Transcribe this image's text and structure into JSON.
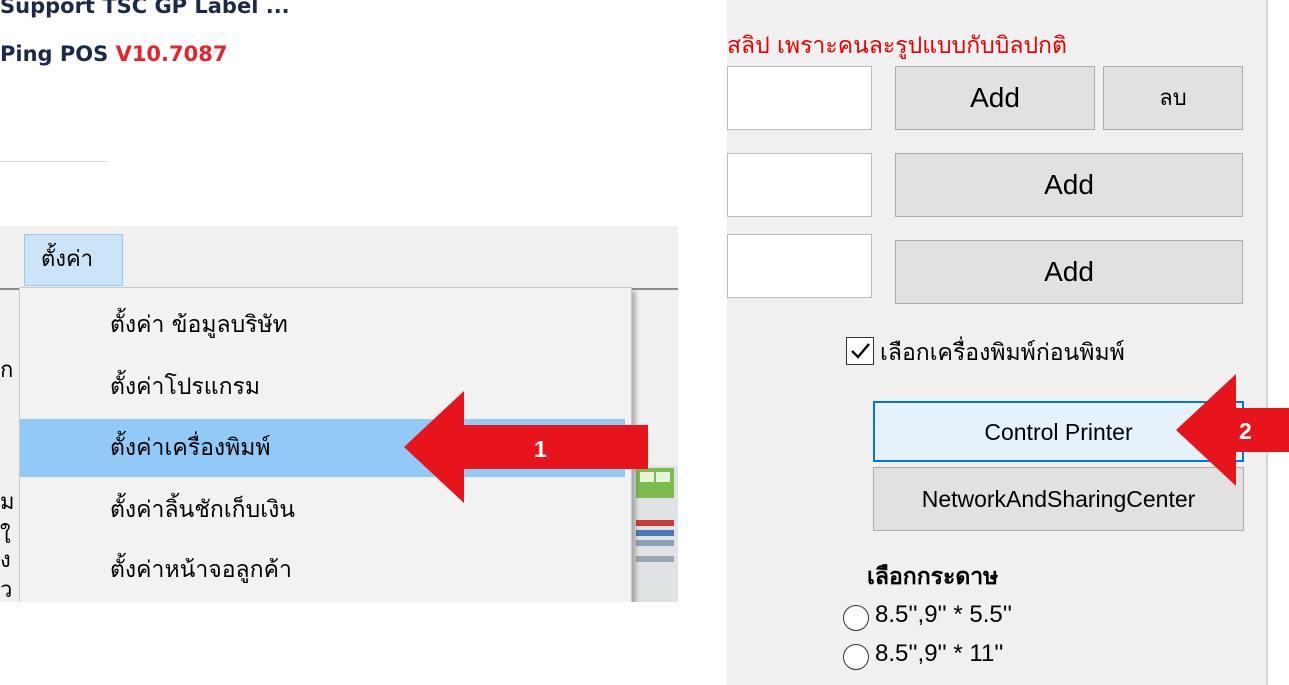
{
  "header": {
    "title": "Support TSC GP Label ...",
    "version_prefix": "Ping POS ",
    "version": "V10.7087"
  },
  "left_panel": {
    "menu_title": "ตั้งค่า",
    "bg_fragments": [
      "ก",
      "ม",
      "ใ",
      "ง",
      "ว"
    ],
    "menu_items": [
      "ตั้งค่า ข้อมูลบริษัท",
      "ตั้งค่าโปรแกรม",
      "ตั้งค่าเครื่องพิมพ์",
      "ตั้งค่าลิ้นชักเก็บเงิน",
      "ตั้งค่าหน้าจอลูกค้า"
    ],
    "highlighted_index": 2
  },
  "right_panel": {
    "warning": "สลิป เพราะคนละรูปแบบกับบิลปกติ",
    "add_label": "Add",
    "delete_label": "ลบ",
    "checkbox_label": "เลือกเครื่องพิมพ์ก่อนพิมพ์",
    "checkbox_checked": true,
    "control_printer_label": "Control Printer",
    "network_label": "NetworkAndSharingCenter",
    "paper_title": "เลือกกระดาษ",
    "paper_options": [
      "8.5'',9'' * 5.5''",
      "8.5'',9'' * 11''"
    ]
  },
  "annotations": {
    "step1": "1",
    "step2": "2",
    "arrow_color": "#e8141b"
  },
  "colors": {
    "title": "#1b2a4a",
    "version": "#e3262e",
    "highlight": "#91c9f7",
    "warning": "#e80000",
    "button_focus_border": "#0078d7"
  }
}
